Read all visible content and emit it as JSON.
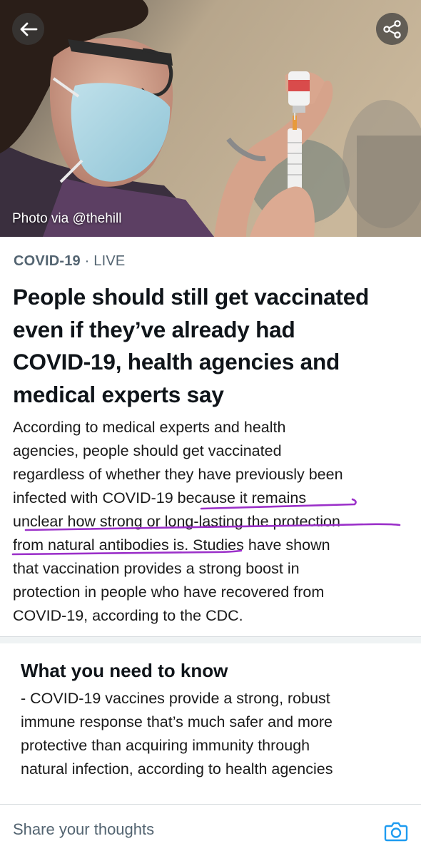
{
  "header": {
    "back_icon": "arrow-left-icon",
    "share_icon": "share-icon",
    "photo_credit": "Photo via @thehill"
  },
  "article": {
    "topic": "COVID-19",
    "separator": "·",
    "status": "LIVE",
    "headline_lines": [
      "People should still get vaccinated",
      "even if they’ve already had",
      "COVID-19, health agencies and",
      "medical experts say"
    ],
    "summary_lines": [
      "According to medical experts and health",
      "agencies, people should get vaccinated",
      "regardless of whether they have previously been",
      "infected with COVID-19 because it remains",
      "unclear how strong or long-lasting the protection",
      "from natural antibodies is. Studies have shown",
      "that vaccination provides a strong boost in",
      "protection in people who have recovered from",
      "COVID-19, according to the CDC."
    ]
  },
  "need_to_know": {
    "title": "What you need to know",
    "body_lines": [
      "- COVID-19 vaccines provide a strong, robust",
      "immune response that’s much safer and more",
      "protective than acquiring immunity through",
      "natural infection, according to health agencies"
    ]
  },
  "composer": {
    "placeholder": "Share your thoughts",
    "camera_icon": "camera-icon"
  },
  "colors": {
    "meta_gray": "#536471",
    "text": "#0f1419",
    "accent_blue": "#1d9bf0",
    "annotation_purple": "#9b30c9"
  }
}
